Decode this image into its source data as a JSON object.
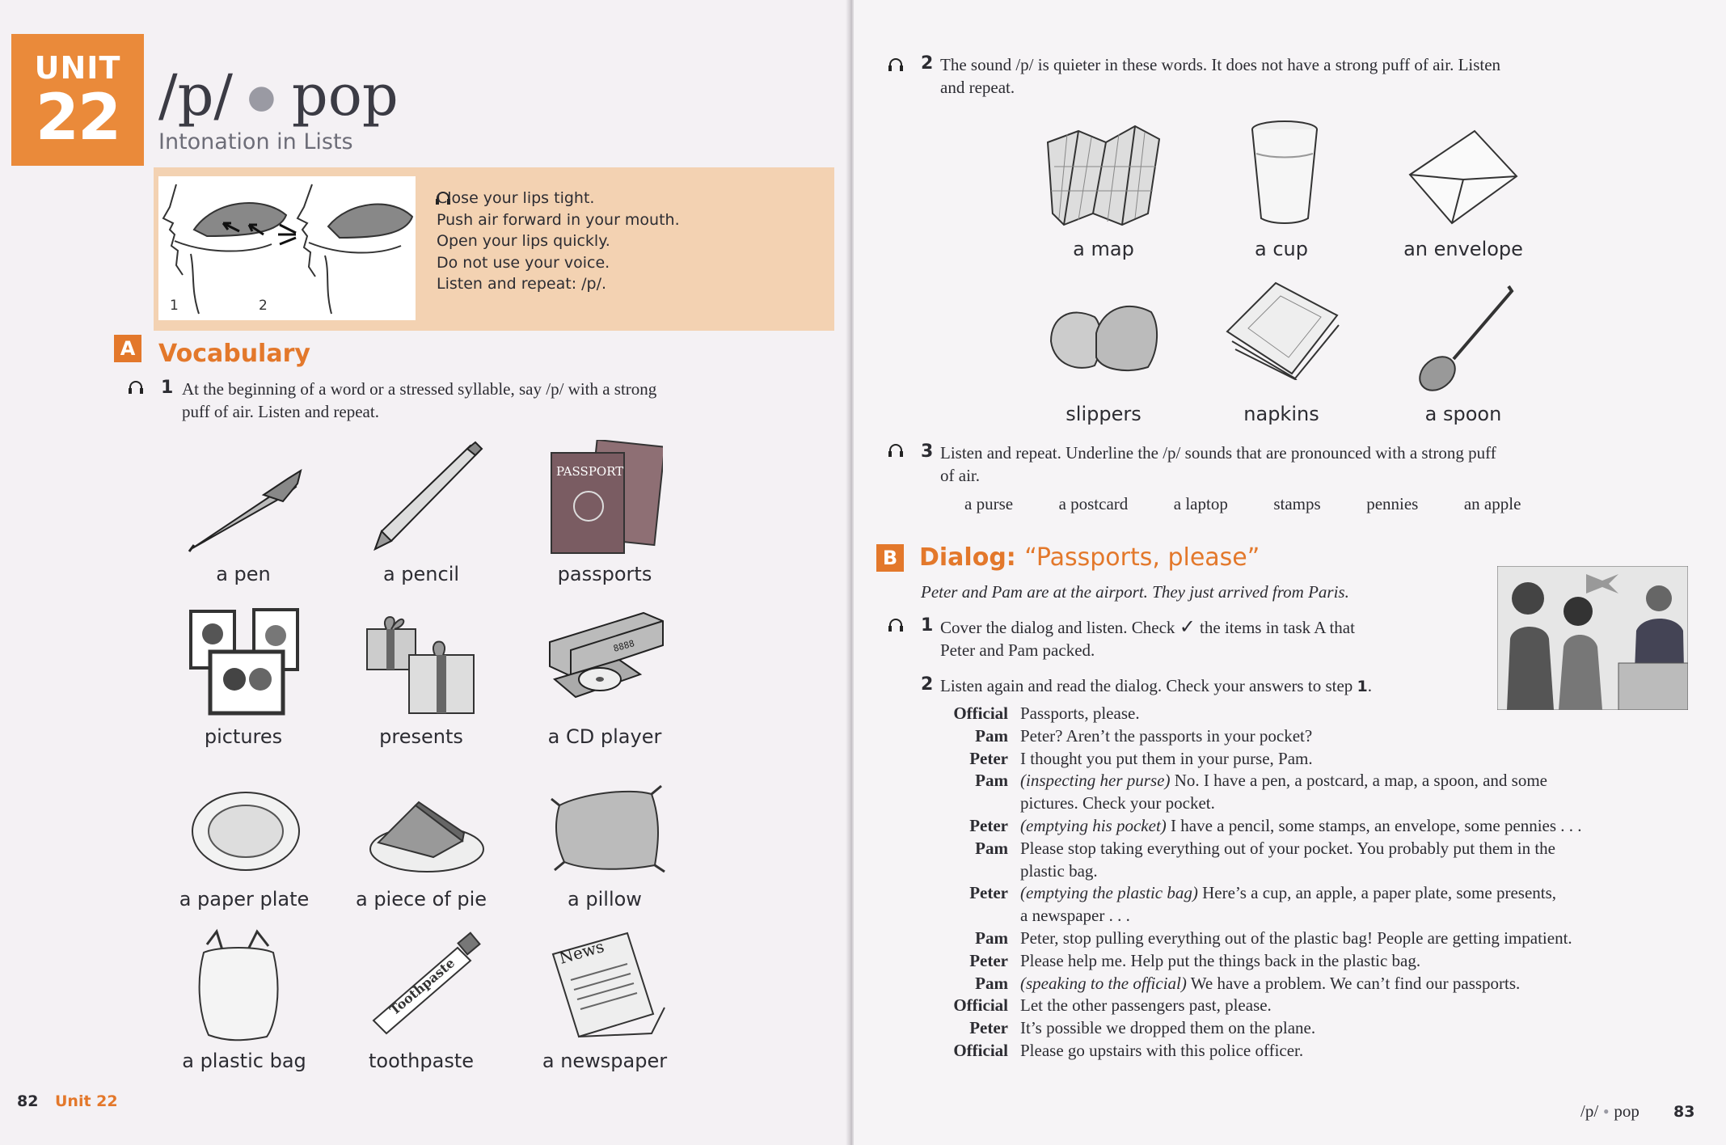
{
  "left_page": {
    "unit_tab": {
      "word": "UNIT",
      "number": "22"
    },
    "title": {
      "sound": "/p/",
      "word": "pop"
    },
    "subtitle": "Intonation in Lists",
    "instructions": {
      "lines": [
        "Close your lips tight.",
        "Push air forward in your mouth.",
        "Open your lips quickly.",
        "Do not use your voice.",
        "Listen and repeat: /p/."
      ],
      "diagram_labels": [
        "1",
        "2"
      ]
    },
    "section_a": {
      "letter": "A",
      "heading": "Vocabulary",
      "step1_num": "1",
      "step1_text_line1": "At the beginning of a word or a stressed syllable, say /p/ with a strong",
      "step1_text_line2": "puff of air. Listen and repeat.",
      "passport_text": "PASSPORT",
      "cd_digits": "8888",
      "tube_text": "Toothpaste",
      "newspaper_text": "News",
      "items": [
        "a pen",
        "a pencil",
        "passports",
        "pictures",
        "presents",
        "a CD player",
        "a paper plate",
        "a piece of pie",
        "a pillow",
        "a plastic bag",
        "toothpaste",
        "a newspaper"
      ]
    },
    "footer": {
      "page": "82",
      "unit": "Unit 22"
    }
  },
  "right_page": {
    "step2": {
      "num": "2",
      "line1": "The sound /p/ is quieter in these words. It does not have a strong puff of air. Listen",
      "line2": "and repeat.",
      "items": [
        "a map",
        "a cup",
        "an envelope",
        "slippers",
        "napkins",
        "a spoon"
      ]
    },
    "step3": {
      "num": "3",
      "line1": "Listen and repeat. Underline the /p/ sounds that are pronounced with a strong puff",
      "line2": "of air.",
      "words": [
        "a purse",
        "a postcard",
        "a laptop",
        "stamps",
        "pennies",
        "an apple"
      ]
    },
    "section_b": {
      "letter": "B",
      "heading_bold": "Dialog:",
      "heading_light": "“Passports, please”",
      "intro": "Peter and Pam are at the airport. They just arrived from Paris.",
      "step1_num": "1",
      "step1_line1_a": "Cover the dialog and listen. Check",
      "check_mark": "✓",
      "step1_line1_b": "the items in task A that",
      "step1_line2": "Peter and Pam packed.",
      "step2_num": "2",
      "step2_text": "Listen again and read the dialog. Check your answers to step",
      "step2_ref": "1",
      "step2_end": "."
    },
    "dialog": [
      {
        "speaker": "Official",
        "lines": [
          "Passports, please."
        ]
      },
      {
        "speaker": "Pam",
        "lines": [
          "Peter? Aren’t the passports in your pocket?"
        ]
      },
      {
        "speaker": "Peter",
        "lines": [
          "I thought you put them in your purse, Pam."
        ]
      },
      {
        "speaker": "Pam",
        "stage": "(inspecting her purse)",
        "lines": [
          " No. I have a pen, a postcard, a map, a spoon, and some",
          "pictures. Check your pocket."
        ]
      },
      {
        "speaker": "Peter",
        "stage": "(emptying his pocket)",
        "lines": [
          " I have a pencil, some stamps, an envelope, some pennies . . ."
        ]
      },
      {
        "speaker": "Pam",
        "lines": [
          "Please stop taking everything out of your pocket. You probably put them in the",
          "plastic bag."
        ]
      },
      {
        "speaker": "Peter",
        "stage": "(emptying the plastic bag)",
        "lines": [
          " Here’s a cup, an apple, a paper plate, some presents,",
          "a newspaper . . ."
        ]
      },
      {
        "speaker": "Pam",
        "lines": [
          "Peter, stop pulling everything out of the plastic bag! People are getting impatient."
        ]
      },
      {
        "speaker": "Peter",
        "lines": [
          "Please help me. Help put the things back in the plastic bag."
        ]
      },
      {
        "speaker": "Pam",
        "stage": "(speaking to the official)",
        "lines": [
          " We have a problem. We can’t find our passports."
        ]
      },
      {
        "speaker": "Official",
        "lines": [
          "Let the other passengers past, please."
        ]
      },
      {
        "speaker": "Peter",
        "lines": [
          "It’s possible we dropped them on the plane."
        ]
      },
      {
        "speaker": "Official",
        "lines": [
          "Please go upstairs with this police officer."
        ]
      }
    ],
    "footer": {
      "sound": "/p/",
      "word": "pop",
      "page": "83"
    }
  }
}
